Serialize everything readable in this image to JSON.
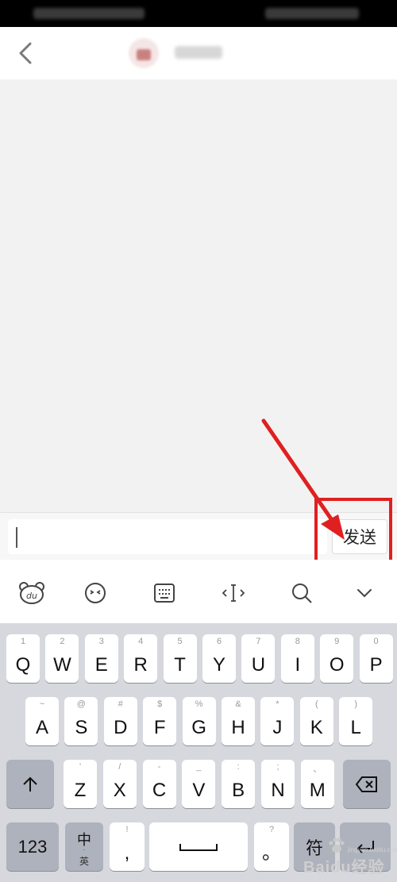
{
  "input": {
    "value": "",
    "send_label": "发送"
  },
  "toolbar": {
    "items": [
      {
        "icon": "du-bear-icon",
        "label": "du"
      },
      {
        "icon": "emoji-icon"
      },
      {
        "icon": "keyboard-icon"
      },
      {
        "icon": "cursor-move-icon"
      },
      {
        "icon": "search-icon"
      },
      {
        "icon": "collapse-keyboard-icon"
      }
    ]
  },
  "keyboard": {
    "row1": [
      {
        "k": "Q",
        "s": "1"
      },
      {
        "k": "W",
        "s": "2"
      },
      {
        "k": "E",
        "s": "3"
      },
      {
        "k": "R",
        "s": "4"
      },
      {
        "k": "T",
        "s": "5"
      },
      {
        "k": "Y",
        "s": "6"
      },
      {
        "k": "U",
        "s": "7"
      },
      {
        "k": "I",
        "s": "8"
      },
      {
        "k": "O",
        "s": "9"
      },
      {
        "k": "P",
        "s": "0"
      }
    ],
    "row2": [
      {
        "k": "A",
        "s": "~"
      },
      {
        "k": "S",
        "s": "@"
      },
      {
        "k": "D",
        "s": "#"
      },
      {
        "k": "F",
        "s": "$"
      },
      {
        "k": "G",
        "s": "%"
      },
      {
        "k": "H",
        "s": "&"
      },
      {
        "k": "J",
        "s": "*"
      },
      {
        "k": "K",
        "s": "("
      },
      {
        "k": "L",
        "s": ")"
      }
    ],
    "row3": [
      {
        "k": "Z",
        "s": "'"
      },
      {
        "k": "X",
        "s": "/"
      },
      {
        "k": "C",
        "s": "-"
      },
      {
        "k": "V",
        "s": "_"
      },
      {
        "k": "B",
        "s": ":"
      },
      {
        "k": "N",
        "s": ";"
      },
      {
        "k": "M",
        "s": "、"
      }
    ],
    "numbers_label": "123",
    "lang_main": "中",
    "lang_sub": "英",
    "comma_sub": "!",
    "comma_main": ",",
    "period_sub": "?",
    "period_main": "。",
    "symbol_label": "符"
  },
  "watermark": {
    "text": "Baidu经验",
    "sub": "jingyan.baidu.com"
  },
  "colors": {
    "annotation": "#e02020",
    "keyboard_bg": "#d6d8de",
    "function_key": "#aeb2bd"
  }
}
